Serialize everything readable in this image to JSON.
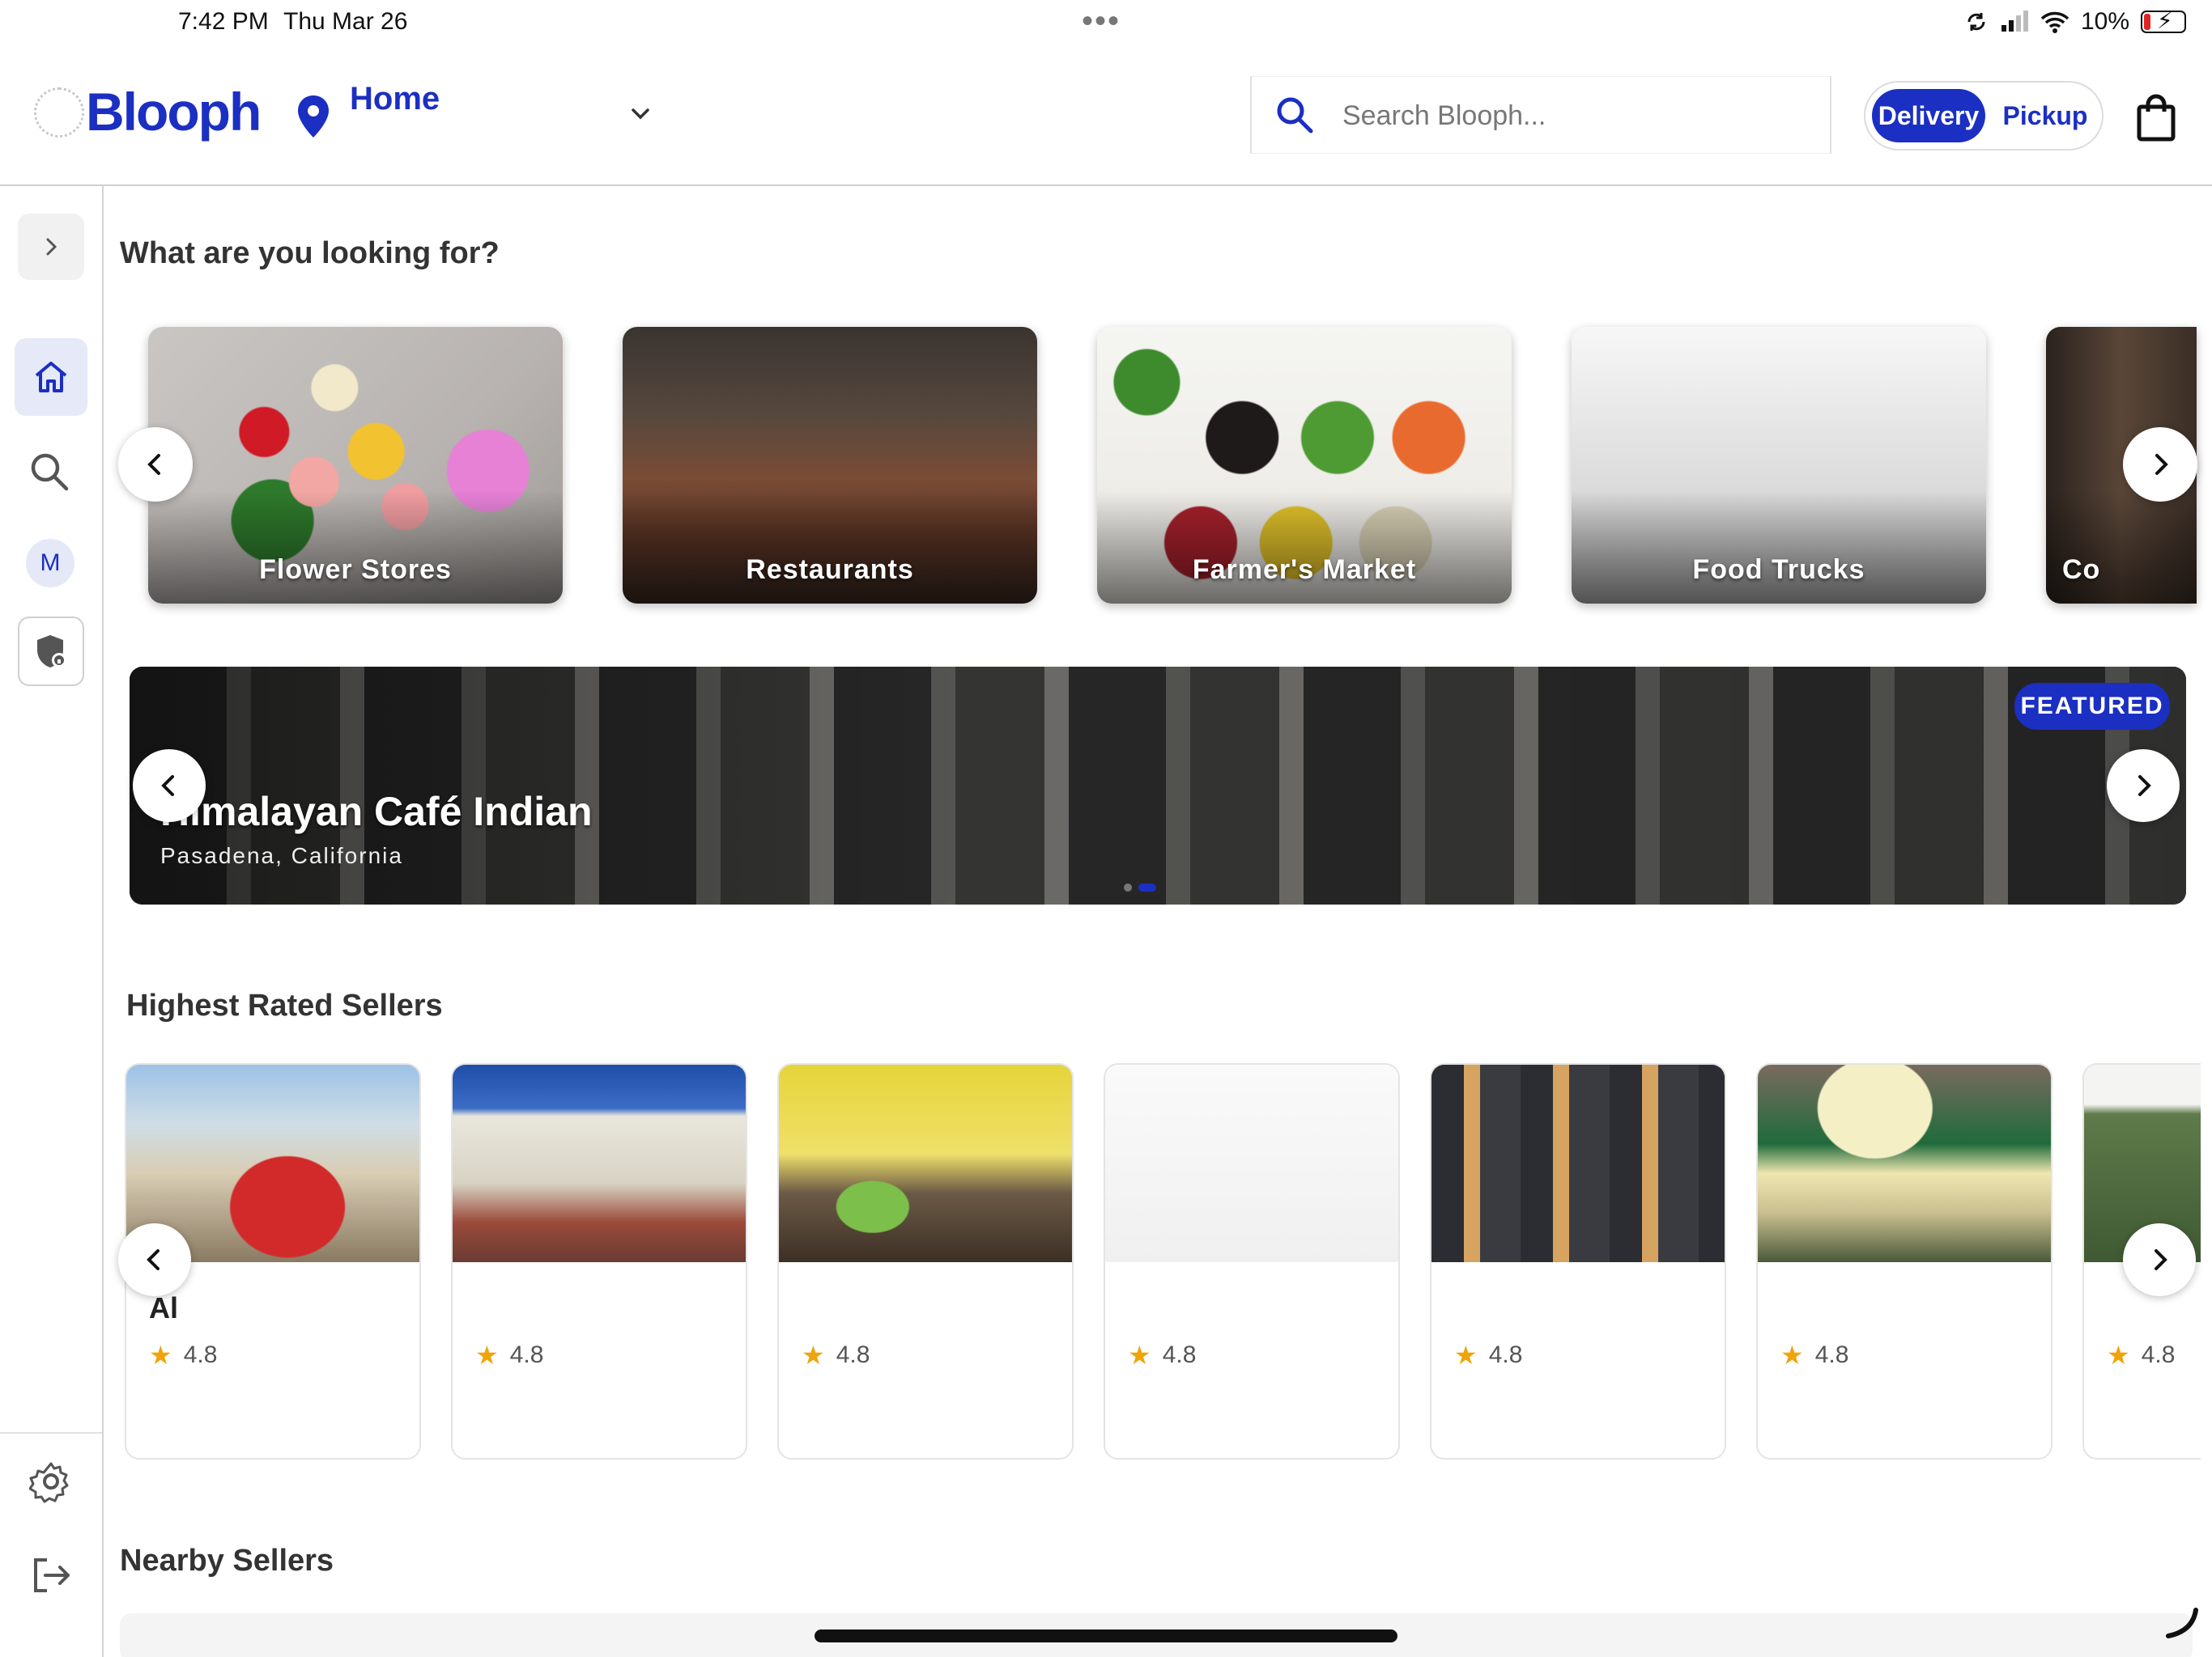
{
  "status_bar": {
    "time": "7:42 PM",
    "date": "Thu Mar 26",
    "battery": "10%"
  },
  "header": {
    "logo": "Blooph",
    "location_label": "Home",
    "search": {
      "placeholder": "Search Blooph...",
      "value": ""
    },
    "mode_toggle": {
      "delivery": "Delivery",
      "pickup": "Pickup",
      "selected": "Delivery"
    }
  },
  "sidebar": {
    "avatar_initial": "M",
    "items": [
      "expand-icon",
      "home-icon",
      "search-icon",
      "avatar",
      "shield-icon",
      "gear-icon",
      "logout-icon"
    ]
  },
  "categories": {
    "title": "What are you looking for?",
    "items": [
      {
        "label": "Flower Stores"
      },
      {
        "label": "Restaurants"
      },
      {
        "label": "Farmer's Market"
      },
      {
        "label": "Food Trucks"
      },
      {
        "label": "Co"
      }
    ]
  },
  "featured": {
    "badge": "FEATURED",
    "title": "Himalayan Café Indian",
    "subtitle": "Pasadena, California",
    "slide_count": 2,
    "active_slide": 2
  },
  "highest_rated": {
    "title": "Highest Rated Sellers",
    "sellers": [
      {
        "name": "Al",
        "rating": "4.8"
      },
      {
        "name": "",
        "rating": "4.8"
      },
      {
        "name": "",
        "rating": "4.8"
      },
      {
        "name": "",
        "rating": "4.8"
      },
      {
        "name": "",
        "rating": "4.8"
      },
      {
        "name": "",
        "rating": "4.8"
      },
      {
        "name": "",
        "rating": "4.8"
      }
    ]
  },
  "nearby": {
    "title": "Nearby Sellers"
  },
  "colors": {
    "brand": "#1b2fc2",
    "star": "#f0a40a"
  }
}
